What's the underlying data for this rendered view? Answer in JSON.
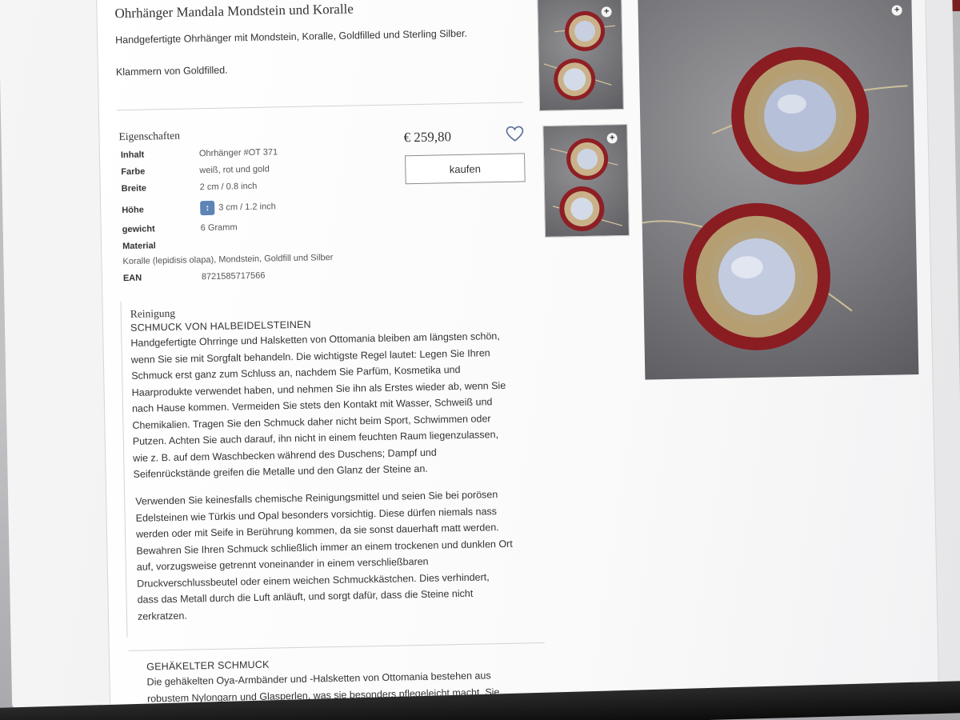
{
  "product": {
    "title": "Ohrhänger Mandala Mondstein und Koralle",
    "lead": "Handgefertigte Ohrhänger mit Mondstein, Koralle, Goldfilled und Sterling Silber.",
    "clasp": "Klammern von Goldfilled."
  },
  "properties": {
    "heading": "Eigenschaften",
    "rows": [
      {
        "label": "Inhalt",
        "value": "Ohrhänger #OT 371"
      },
      {
        "label": "Farbe",
        "value": "weiß, rot und gold"
      },
      {
        "label": "Breite",
        "value": "2 cm / 0.8 inch"
      },
      {
        "label": "Höhe",
        "value": "3 cm / 1.2 inch"
      },
      {
        "label": "gewicht",
        "value": "6 Gramm"
      },
      {
        "label": "Material",
        "value": ""
      },
      {
        "label": "EAN",
        "value": "8721585717566"
      }
    ],
    "material_text": "Koralle (lepidisis olapa), Mondstein, Goldfill und Silber"
  },
  "purchase": {
    "price": "€ 259,80",
    "buy_label": "kaufen"
  },
  "gallery": {
    "zoom_symbol": "+"
  },
  "cleaning": {
    "heading": "Reinigung",
    "subheading": "SCHMUCK VON HALBEIDELSTEINEN",
    "para1": "Handgefertigte Ohrringe und Halsketten von Ottomania bleiben am längsten schön,\nwenn Sie sie mit Sorgfalt behandeln. Die wichtigste Regel lautet: Legen Sie Ihren\nSchmuck erst ganz zum Schluss an, nachdem Sie Parfüm, Kosmetika und\nHaarprodukte verwendet haben, und nehmen Sie ihn als Erstes wieder ab, wenn Sie\nnach Hause kommen. Vermeiden Sie stets den Kontakt mit Wasser, Schweiß und\nChemikalien. Tragen Sie den Schmuck daher nicht beim Sport, Schwimmen oder\nPutzen. Achten Sie auch darauf, ihn nicht in einem feuchten Raum liegenzulassen,\nwie z. B. auf dem Waschbecken während des Duschens; Dampf und\nSeifenrückstände greifen die Metalle und den Glanz der Steine an.",
    "para2": "Verwenden Sie keinesfalls chemische Reinigungsmittel und seien Sie bei porösen\nEdelsteinen wie Türkis und Opal besonders vorsichtig. Diese dürfen niemals nass\nwerden oder mit Seife in Berührung kommen, da sie sonst dauerhaft matt werden.\nBewahren Sie Ihren Schmuck schließlich immer an einem trockenen und dunklen Ort\nauf, vorzugsweise getrennt voneinander in einem verschließbaren\nDruckverschlussbeutel oder einem weichen Schmuckkästchen. Dies verhindert,\ndass das Metall durch die Luft anläuft, und sorgt dafür, dass die Steine nicht\nzerkratzen.",
    "sub2": "GEHÄKELTER SCHMUCK",
    "para3": "Die gehäkelten Oya-Armbänder und -Halsketten von Ottomania bestehen aus\nrobustem Nylongarn und Glasperlen, was sie besonders pflegeleicht macht. Sie"
  }
}
